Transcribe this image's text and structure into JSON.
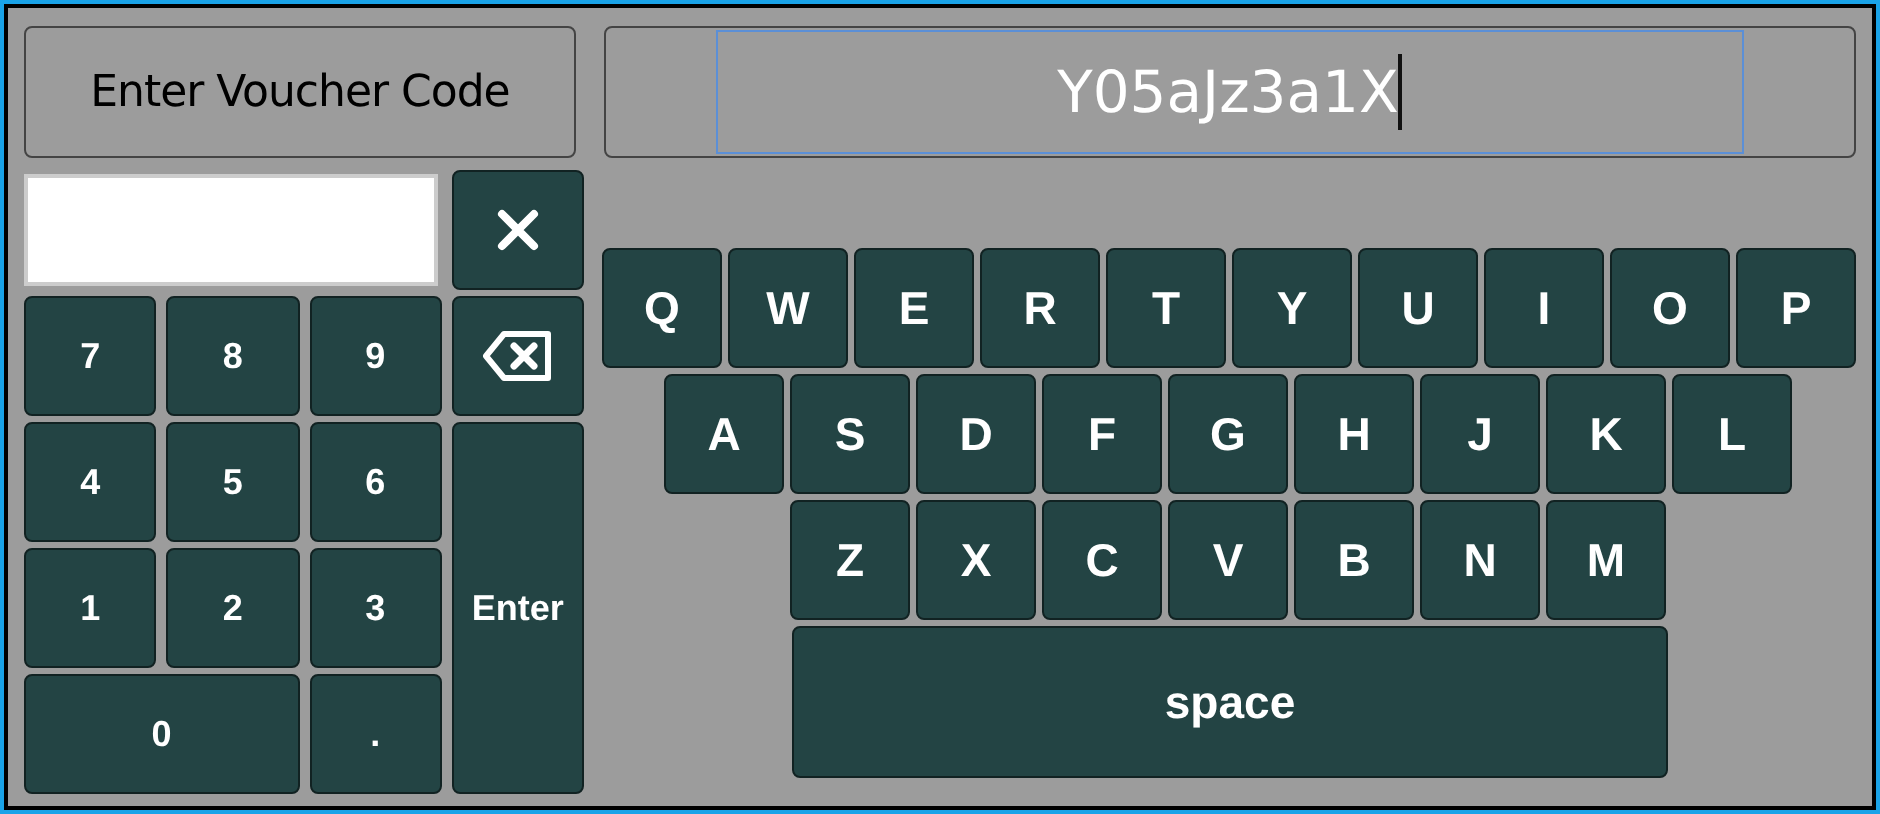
{
  "prompt_label": "Enter Voucher Code",
  "voucher_field": {
    "value": "Y05aJz3a1X"
  },
  "numpad": [
    {
      "kind": "input"
    },
    {
      "kind": "clear"
    },
    {
      "kind": "digit",
      "label": "7"
    },
    {
      "kind": "digit",
      "label": "8"
    },
    {
      "kind": "digit",
      "label": "9"
    },
    {
      "kind": "backspace"
    },
    {
      "kind": "digit",
      "label": "4"
    },
    {
      "kind": "digit",
      "label": "5"
    },
    {
      "kind": "digit",
      "label": "6"
    },
    {
      "kind": "digit",
      "label": "1"
    },
    {
      "kind": "digit",
      "label": "2"
    },
    {
      "kind": "digit",
      "label": "3"
    },
    {
      "kind": "enter",
      "label": "Enter"
    },
    {
      "kind": "wide",
      "label": "0"
    },
    {
      "kind": "digit",
      "label": "."
    }
  ],
  "keyboard_rows": [
    [
      "Q",
      "W",
      "E",
      "R",
      "T",
      "Y",
      "U",
      "I",
      "O",
      "P"
    ],
    [
      "A",
      "S",
      "D",
      "F",
      "G",
      "H",
      "J",
      "K",
      "L"
    ],
    [
      "Z",
      "X",
      "C",
      "V",
      "B",
      "N",
      "M"
    ]
  ],
  "space_key": "space"
}
